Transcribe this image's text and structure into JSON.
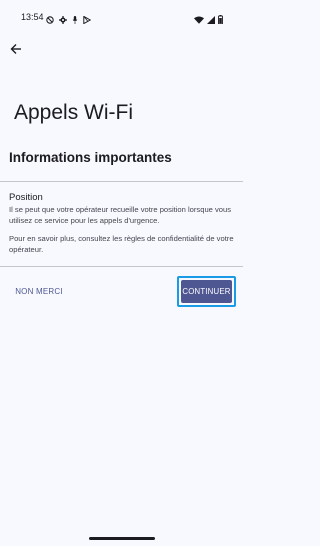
{
  "status_bar": {
    "time": "13:54",
    "left_icons": [
      "do-not-disturb-icon",
      "gear-icon",
      "mic-icon",
      "play-store-icon"
    ],
    "right_icons": [
      "wifi-icon",
      "cell-signal-icon",
      "battery-icon"
    ]
  },
  "header": {
    "back_icon": "arrow-left-icon"
  },
  "page": {
    "title": "Appels Wi-Fi",
    "section_title": "Informations importantes"
  },
  "info": {
    "heading": "Position",
    "paragraph1": "Il se peut que votre opérateur recueille votre position lorsque vous utilisez ce service pour les appels d'urgence.",
    "paragraph2": "Pour en savoir plus, consultez les règles de confidentialité de votre opérateur."
  },
  "actions": {
    "decline_label": "NON MERCI",
    "continue_label": "CONTINUER"
  },
  "colors": {
    "accent": "#4e5791",
    "focus": "#1a9be6",
    "background": "#f8f9ff"
  }
}
